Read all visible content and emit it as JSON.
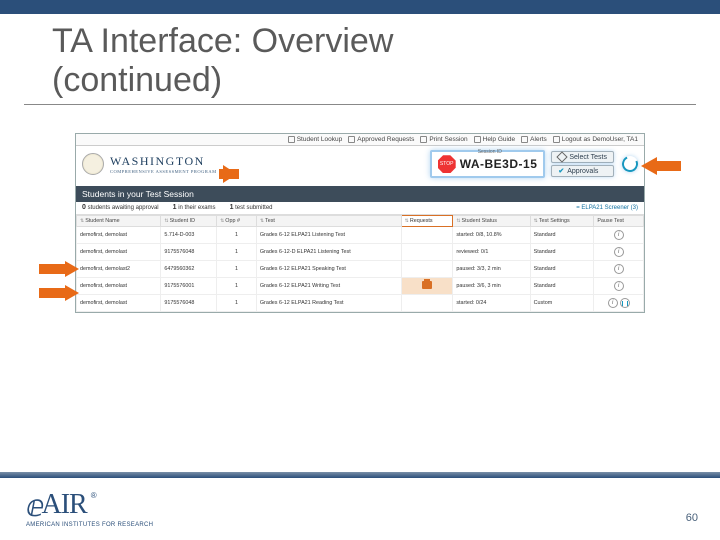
{
  "slide": {
    "title_line1": "TA Interface: Overview",
    "title_line2": "(continued)",
    "page_number": "60"
  },
  "toolbar": {
    "lookup": "Student Lookup",
    "approved": "Approved Requests",
    "print": "Print Session",
    "help": "Help Guide",
    "alerts": "Alerts",
    "logout": "Logout as",
    "user": "DemoUser, TA1"
  },
  "brand": {
    "name": "WASHINGTON",
    "subtitle": "COMPREHENSIVE ASSESSMENT PROGRAM"
  },
  "session": {
    "label": "Session ID",
    "stop": "STOP",
    "id": "WA-BE3D-15",
    "select_tests": "Select Tests",
    "approvals": "Approvals"
  },
  "panel": {
    "title": "Students in your Test Session"
  },
  "summary": {
    "awaiting_n": "0",
    "awaiting_t": "students awaiting approval",
    "prog_n": "1",
    "prog_t": "in their exams",
    "done_n": "1",
    "done_t": "test submitted",
    "right_link": "= ELPA21 Screener (3)"
  },
  "columns": {
    "name": "Student Name",
    "id": "Student ID",
    "opp": "Opp #",
    "test": "Test",
    "req": "Requests",
    "status": "Student Status",
    "settings": "Test Settings",
    "pause": "Pause Test"
  },
  "rows": [
    {
      "name": "demofirst, demolast",
      "id": "5.714-D-003",
      "opp": "1",
      "test": "Grades 6-12 ELPA21 Listening Test",
      "status": "started: 0/8, 10.8%",
      "settings": "Standard"
    },
    {
      "name": "demofirst, demolast",
      "id": "9175576048",
      "opp": "1",
      "test": "Grades 6-12-D ELPA21 Listening Test",
      "status": "reviewed: 0/1",
      "settings": "Standard"
    },
    {
      "name": "demofirst, demolast2",
      "id": "6479560362",
      "opp": "1",
      "test": "Grades 6-12 ELPA21 Speaking Test",
      "status": "paused: 3/3, 2 min",
      "settings": "Standard"
    },
    {
      "name": "demofirst, demolast",
      "id": "9175576001",
      "opp": "1",
      "test": "Grades 6-12 ELPA21 Writing Test",
      "status": "paused: 3/6, 3 min",
      "settings": "Standard"
    },
    {
      "name": "demofirst, demolast",
      "id": "9175576048",
      "opp": "1",
      "test": "Grades 6-12 ELPA21 Reading Test",
      "status": "started: 0/24",
      "settings": "Custom"
    }
  ],
  "footer": {
    "logo_text": "AIR",
    "reg": "®",
    "tagline": "AMERICAN INSTITUTES FOR RESEARCH"
  }
}
